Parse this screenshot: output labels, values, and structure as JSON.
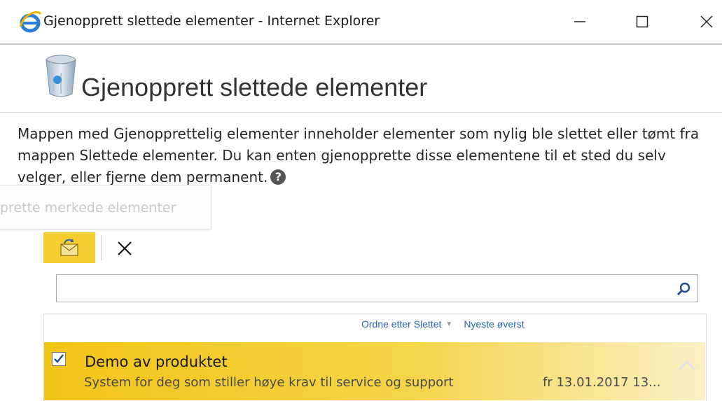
{
  "window": {
    "title": "Gjenopprett slettede elementer - Internet Explorer",
    "icon": "internet-explorer-icon",
    "controls": {
      "minimize": "minimize-icon",
      "maximize": "maximize-icon",
      "close": "close-icon"
    }
  },
  "header": {
    "icon": "recycle-bin-icon",
    "title": "Gjenopprett slettede elementer"
  },
  "description": {
    "text": "Mappen med Gjenopprettelig elementer inneholder elementer som nylig ble slettet eller tømt fra mappen Slettede elementer. Du kan enten gjenopprette disse elementene til et sted du selv velger, eller fjerne dem permanent.",
    "help_icon": "help-icon",
    "help_glyph": "?"
  },
  "tooltip": {
    "text": "prette merkede elementer"
  },
  "toolbar": {
    "restore_icon": "restore-mail-icon",
    "delete_icon": "delete-x-icon"
  },
  "search": {
    "value": "",
    "placeholder": "",
    "icon": "search-icon"
  },
  "list": {
    "sort_label": "Ordne etter Slettet",
    "order_label": "Nyeste øverst",
    "items": [
      {
        "title": "Demo av produktet",
        "subtitle": "System for deg som stiller høye krav til service og support",
        "date": "fr 13.01.2017 13...",
        "checked": true,
        "selected": true
      }
    ]
  },
  "colors": {
    "accent_yellow": "#f5cf2f",
    "link_blue": "#2a67b0",
    "title_grey": "#333333"
  }
}
